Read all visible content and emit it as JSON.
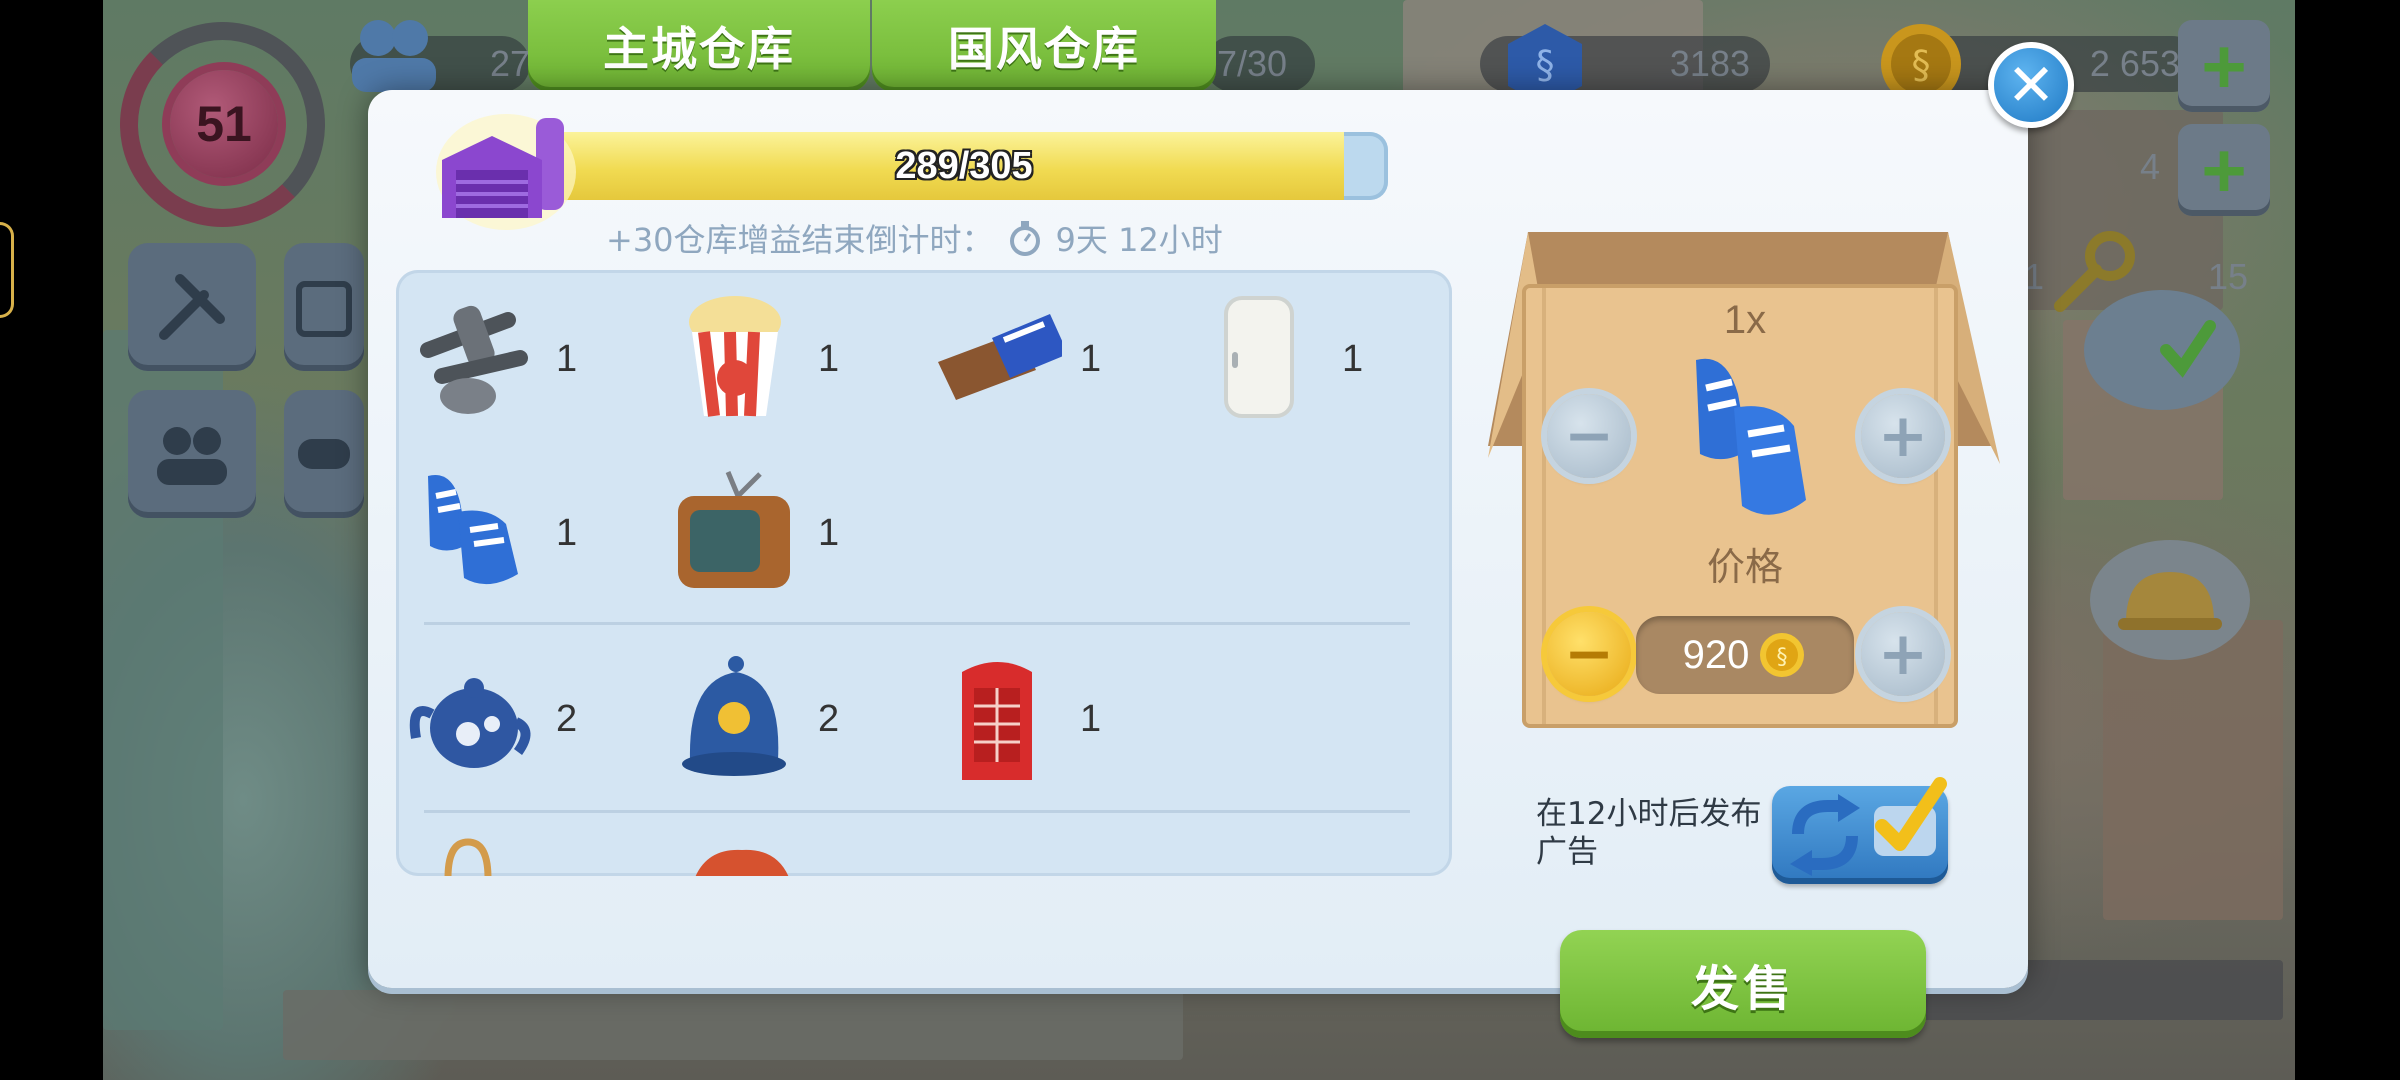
{
  "tabs": [
    {
      "label": "主城仓库",
      "active": true
    },
    {
      "label": "国风仓库",
      "active": false
    }
  ],
  "hud": {
    "level": "51",
    "population_partial": "27",
    "count_partial": "7/30",
    "currency_1": "3183",
    "currency_2": "2 653",
    "right_col_1": "4",
    "right_col_2": "1",
    "right_col_3": "15"
  },
  "storage": {
    "capacity_text": "289/305",
    "used": 289,
    "total": 305,
    "boost_label": "+30仓库增益结束倒计时：",
    "boost_time": "9天 12小时"
  },
  "inventory": {
    "items": [
      {
        "icon": "nails-icon",
        "qty": "1"
      },
      {
        "icon": "popcorn-icon",
        "qty": "1"
      },
      {
        "icon": "chocolate-bar-icon",
        "qty": "1"
      },
      {
        "icon": "fridge-icon",
        "qty": "1"
      },
      {
        "icon": "football-boots-icon",
        "qty": "1"
      },
      {
        "icon": "tv-icon",
        "qty": "1"
      },
      {
        "icon": "teapot-icon",
        "qty": "2"
      },
      {
        "icon": "police-helmet-icon",
        "qty": "2"
      },
      {
        "icon": "phone-booth-icon",
        "qty": "1"
      }
    ]
  },
  "sale": {
    "quantity": "1x",
    "selected_item_icon": "football-boots-icon",
    "price_label": "价格",
    "price": "920",
    "ad_text": "在12小时后发布广告",
    "sell_label": "发售"
  },
  "colors": {
    "tab_green": "#7cc242",
    "dialog_bg": "#eef4f9",
    "bar_fill": "#f1db52",
    "close_blue": "#2a86d0"
  }
}
